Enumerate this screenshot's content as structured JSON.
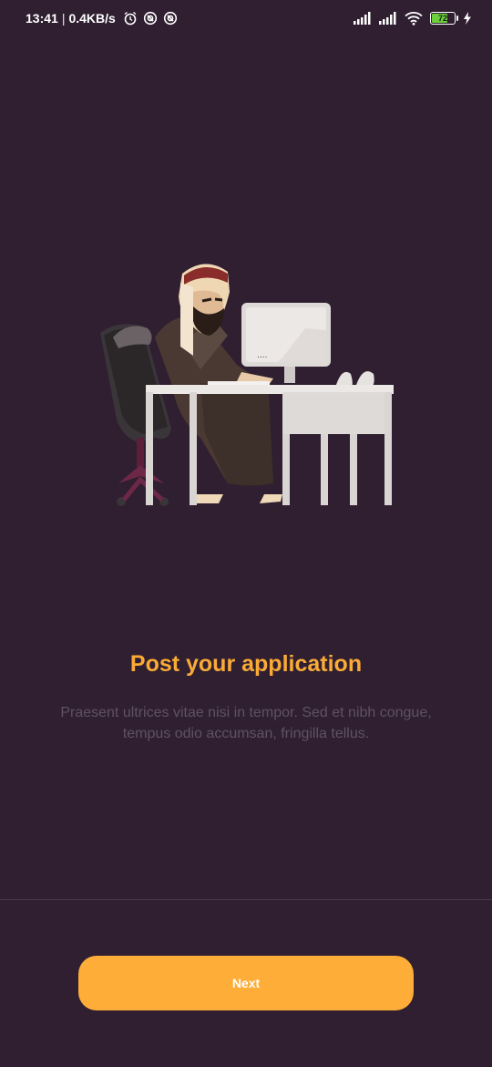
{
  "status_bar": {
    "time": "13:41",
    "network_speed": "0.4KB/s",
    "battery_level": "72",
    "icons_left": [
      "alarm-icon",
      "sync-icon",
      "sync-icon"
    ],
    "icons_right": [
      "signal-icon",
      "signal-icon",
      "wifi-icon",
      "battery-icon",
      "charging-icon"
    ]
  },
  "onboarding": {
    "illustration": "man-at-computer-desk",
    "title": "Post your application",
    "description": "Praesent ultrices vitae nisi in tempor. Sed et nibh congue, tempus odio accumsan, fringilla tellus."
  },
  "footer": {
    "next_label": "Next"
  },
  "colors": {
    "background": "#2f1f31",
    "accent": "#fdad38",
    "title": "#f9ab36",
    "description": "#5e5264"
  }
}
